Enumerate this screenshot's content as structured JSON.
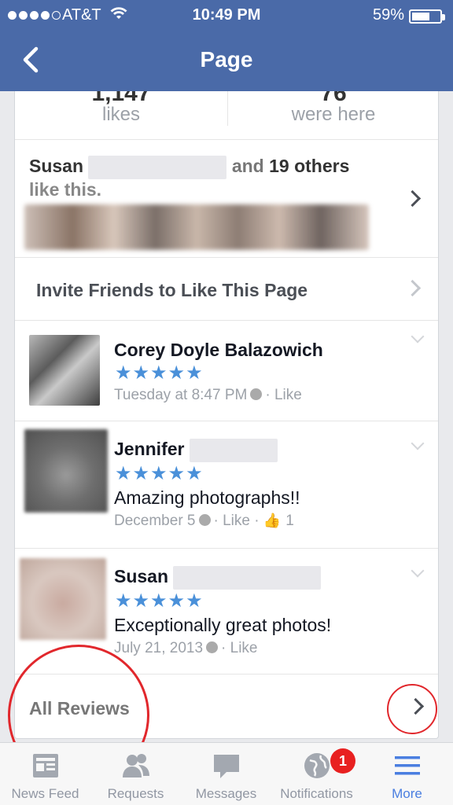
{
  "status_bar": {
    "carrier": "AT&T",
    "time": "10:49 PM",
    "battery": "59%"
  },
  "nav": {
    "title": "Page"
  },
  "stats": [
    {
      "value": "1,147",
      "label": "likes"
    },
    {
      "value": "76",
      "label": "were here"
    }
  ],
  "friends_like": {
    "first_name": "Susan",
    "suffix": "and",
    "count": "19 others",
    "line2": "like this."
  },
  "invite": {
    "label": "Invite Friends to Like This Page"
  },
  "reviews": [
    {
      "name": "Corey Doyle Balazowich",
      "stars": "★★★★★",
      "text": "",
      "date": "Tuesday at 8:47 PM",
      "action": "Like",
      "likes": ""
    },
    {
      "name": "Jennifer",
      "stars": "★★★★★",
      "text": "Amazing photographs!!",
      "date": "December 5",
      "action": "Like",
      "likes": "1"
    },
    {
      "name": "Susan",
      "stars": "★★★★★",
      "text": "Exceptionally great photos!",
      "date": "July 21, 2013",
      "action": "Like",
      "likes": ""
    }
  ],
  "all_reviews": {
    "label": "All Reviews"
  },
  "tabs": [
    {
      "label": "News Feed",
      "icon": "news-feed-icon"
    },
    {
      "label": "Requests",
      "icon": "friend-requests-icon"
    },
    {
      "label": "Messages",
      "icon": "messages-icon"
    },
    {
      "label": "Notifications",
      "icon": "globe-icon",
      "badge": "1"
    },
    {
      "label": "More",
      "icon": "menu-icon"
    }
  ],
  "colors": {
    "brand": "#4a6aa8",
    "star": "#4a90d9",
    "annotation_red": "#e1272c",
    "active_tab": "#4a7ee0"
  }
}
